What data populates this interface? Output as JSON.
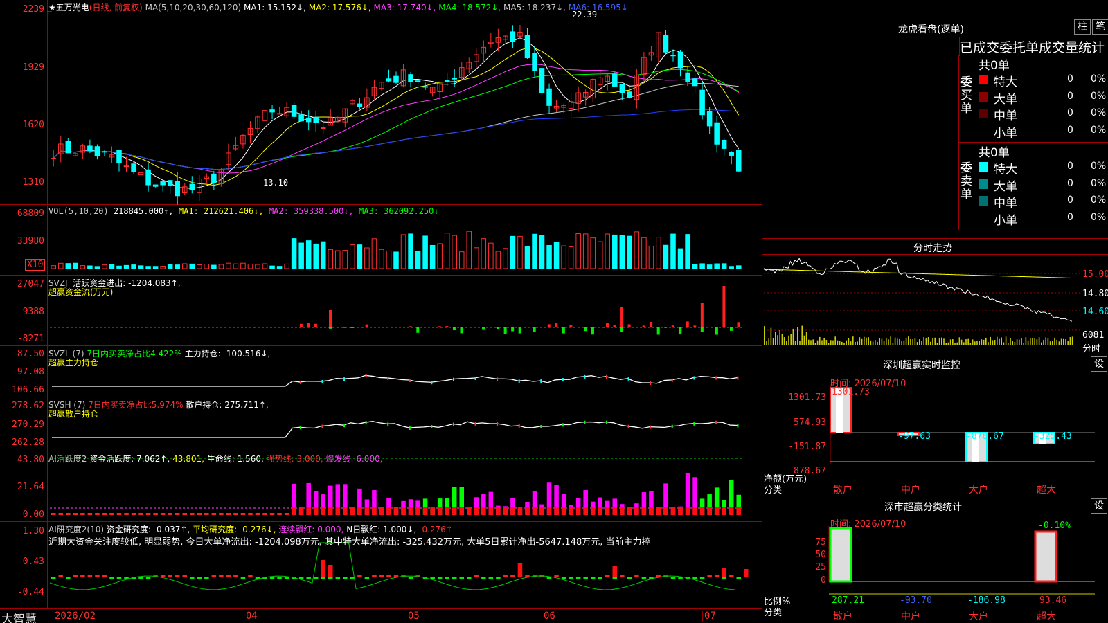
{
  "main": {
    "title": "★五万光电",
    "mode": "(日线, 前复权)",
    "ma_label": "MA(5,10,20,30,60,120)",
    "ma1": "MA1: 15.152↓,",
    "ma2": "MA2: 17.576↓,",
    "ma3": "MA3: 17.740↓,",
    "ma4": "MA4: 18.572↓,",
    "ma5": "MA5: 18.237↓,",
    "ma6": "MA6: 16.595↓",
    "y": [
      "2239",
      "1929",
      "1620",
      "1310"
    ],
    "high_mark": "22.39",
    "low_mark": "13.10"
  },
  "vol": {
    "label": "VOL(5,10,20)",
    "value": "218845.000↑,",
    "ma1": "MA1: 212621.406↓,",
    "ma2": "MA2: 359338.500↓,",
    "ma3": "MA3: 362092.250↓",
    "y": [
      "68809",
      "33980"
    ],
    "unit": "X10"
  },
  "svzj": {
    "label": "SVZJ",
    "text": "活跃资金进出: -1204.083↑,",
    "sub": "超赢资金流(万元)",
    "y": [
      "27047",
      "9388",
      "-8271"
    ]
  },
  "svzl": {
    "label": "SVZL (7)",
    "text1": "7日内买卖净占比4.422%",
    "text2": "主力持仓: -100.516↓,",
    "sub": "超赢主力持仓",
    "y": [
      "-87.50",
      "-97.08",
      "-106.66"
    ]
  },
  "svsh": {
    "label": "SVSH (7)",
    "text1": "7日内买卖净占比5.974%",
    "text2": "散户持仓: 275.711↑,",
    "sub": "超赢散户持仓",
    "y": [
      "278.62",
      "270.29",
      "262.28"
    ]
  },
  "ai1": {
    "label": "AI活跃度2",
    "t1": "资金活跃度: 7.062↑,",
    "t2": "43.801,",
    "t3": "生命线: 1.560,",
    "t4": "强势线: 3.000,",
    "t5": "爆发线: 6.000,",
    "y": [
      "43.80",
      "21.64",
      "0.00"
    ]
  },
  "ai2": {
    "label": "AI研究度2(10)",
    "t1": "资金研究度: -0.037↑,",
    "t2": "平均研究度: -0.276↓,",
    "t3": "连续飘红: 0.000,",
    "t4": "N日飘红: 1.000↓,",
    "t5": "-0.276↑",
    "comment": "近期大资金关注度较低, 明显弱势, 今日大单净流出: -1204.098万元, 其中特大单净流出: -325.432万元, 大单5日累计净出-5647.148万元, 当前主力控",
    "y": [
      "1.30",
      "0.43",
      "-0.44"
    ]
  },
  "xaxis": {
    "brand": "大智慧",
    "labels": [
      "2026/02",
      "04",
      "05",
      "06",
      "07"
    ]
  },
  "lhb": {
    "title": "龙虎看盘(逐单)",
    "btn1": "柱",
    "btn2": "笔",
    "subtitle": "已成交委托单成交量统计",
    "buy_side": "委买单",
    "sell_side": "委卖单",
    "buy_total": "共0单",
    "sell_total": "共0单",
    "buy_rows": [
      {
        "name": "特大",
        "v": "0",
        "p": "0%",
        "color": "#ff0000"
      },
      {
        "name": "大单",
        "v": "0",
        "p": "0%",
        "color": "#8b0000"
      },
      {
        "name": "中单",
        "v": "0",
        "p": "0%",
        "color": "#5a0000"
      },
      {
        "name": "小单",
        "v": "0",
        "p": "0%",
        "color": ""
      }
    ],
    "sell_rows": [
      {
        "name": "特大",
        "v": "0",
        "p": "0%",
        "color": "#00ffff"
      },
      {
        "name": "大单",
        "v": "0",
        "p": "0%",
        "color": "#008b8b"
      },
      {
        "name": "中单",
        "v": "0",
        "p": "0%",
        "color": "#007070"
      },
      {
        "name": "小单",
        "v": "0",
        "p": "0%",
        "color": ""
      }
    ]
  },
  "intraday": {
    "title": "分时走势",
    "y": [
      "15.00",
      "14.80",
      "14.60"
    ],
    "vol": "6081",
    "vol_label": "分时"
  },
  "sz_monitor": {
    "title": "深圳超赢实时监控",
    "btn": "设",
    "time": "时间: 2026/07/10",
    "top": "1301.73",
    "y": [
      "1301.73",
      "574.93",
      "-151.87",
      "-878.67"
    ],
    "values": [
      "-97.63",
      "-878.67",
      "-325.43"
    ],
    "ylabel": "净额(万元)",
    "xlabel": "分类",
    "cats": [
      "散户",
      "中户",
      "大户",
      "超大"
    ]
  },
  "sz_class": {
    "title": "深市超赢分类统计",
    "btn": "设",
    "time": "时间: 2026/07/10",
    "top": "-0.10%",
    "y": [
      "75",
      "50",
      "25",
      "0"
    ],
    "vals": [
      "287.21",
      "-93.70",
      "-186.98",
      "93.46"
    ],
    "ylabel": "比例%",
    "xlabel": "分类",
    "cats": [
      "散户",
      "中户",
      "大户",
      "超大"
    ]
  }
}
